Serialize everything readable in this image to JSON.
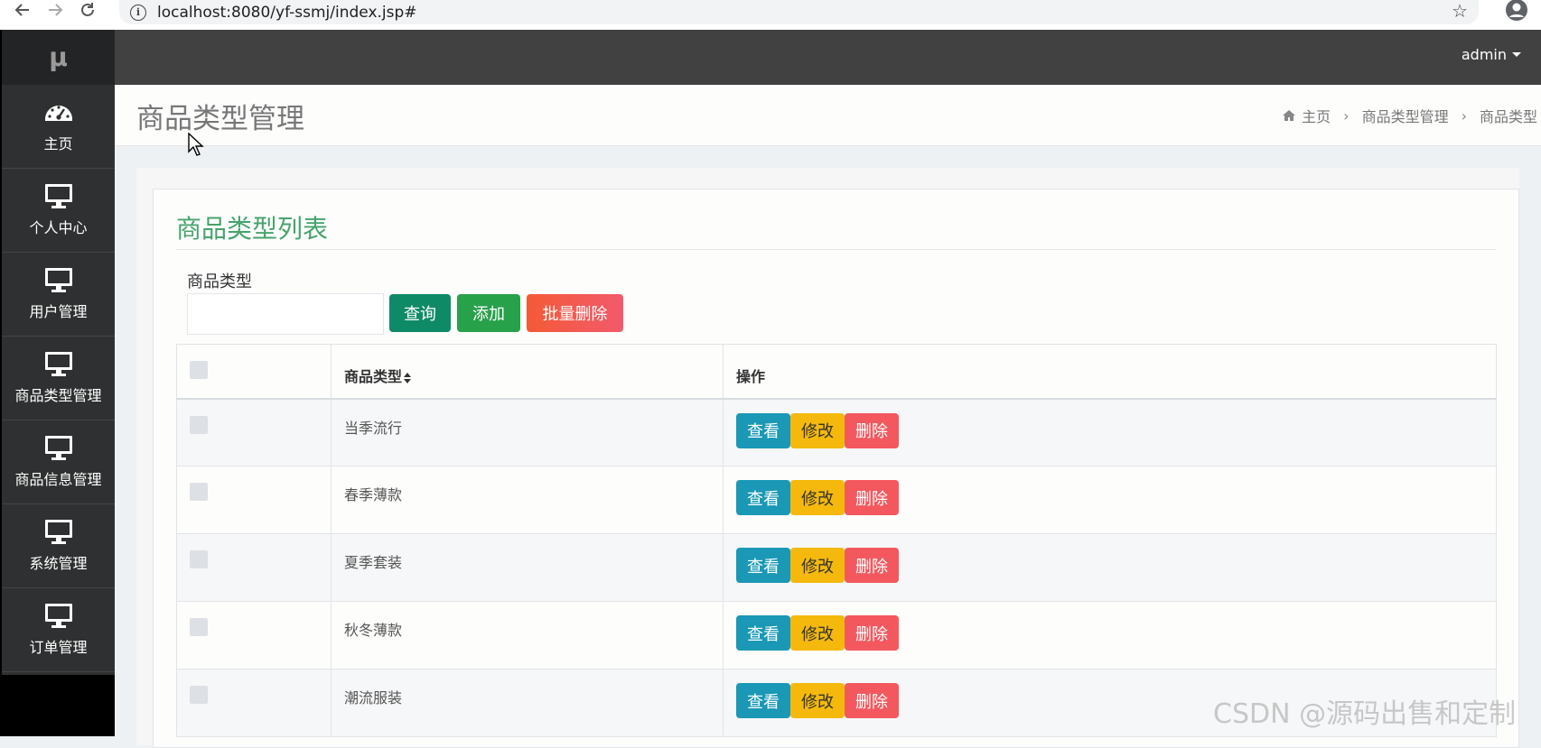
{
  "browser": {
    "url": "localhost:8080/yf-ssmj/index.jsp#",
    "back_icon": "arrow-left-icon",
    "forward_icon": "arrow-right-icon",
    "reload_icon": "reload-icon",
    "star_icon": "bookmark-star-icon",
    "account_icon": "account-circle-icon"
  },
  "sidebar": {
    "logo": "μ",
    "items": [
      {
        "label": "主页",
        "icon": "dashboard-gauge-icon"
      },
      {
        "label": "个人中心",
        "icon": "monitor-icon"
      },
      {
        "label": "用户管理",
        "icon": "monitor-icon"
      },
      {
        "label": "商品类型管理",
        "icon": "monitor-icon"
      },
      {
        "label": "商品信息管理",
        "icon": "monitor-icon"
      },
      {
        "label": "系统管理",
        "icon": "monitor-icon"
      },
      {
        "label": "订单管理",
        "icon": "monitor-icon"
      }
    ]
  },
  "topbar": {
    "user": "admin"
  },
  "page_header": {
    "title": "商品类型管理",
    "breadcrumb": [
      "主页",
      "商品类型管理",
      "商品类型"
    ]
  },
  "card": {
    "title": "商品类型列表",
    "search_label": "商品类型",
    "search_value": "",
    "buttons": {
      "query": "查询",
      "add": "添加",
      "batch_delete": "批量删除"
    }
  },
  "table": {
    "headers": [
      "",
      "商品类型",
      "操作"
    ],
    "rows": [
      {
        "name": "当季流行"
      },
      {
        "name": "春季薄款"
      },
      {
        "name": "夏季套装"
      },
      {
        "name": "秋冬薄款"
      },
      {
        "name": "潮流服装"
      }
    ],
    "actions": {
      "view": "查看",
      "edit": "修改",
      "delete": "删除"
    }
  },
  "colors": {
    "sidebar": "#2f3031",
    "topbar": "#404140",
    "title_green": "#46a36b",
    "query": "#0f8a67",
    "add": "#27a14a",
    "batch": "#f45a36",
    "view": "#1a98b6",
    "edit": "#f4b90c",
    "delete": "#f3585e"
  },
  "watermark": "CSDN @源码出售和定制"
}
